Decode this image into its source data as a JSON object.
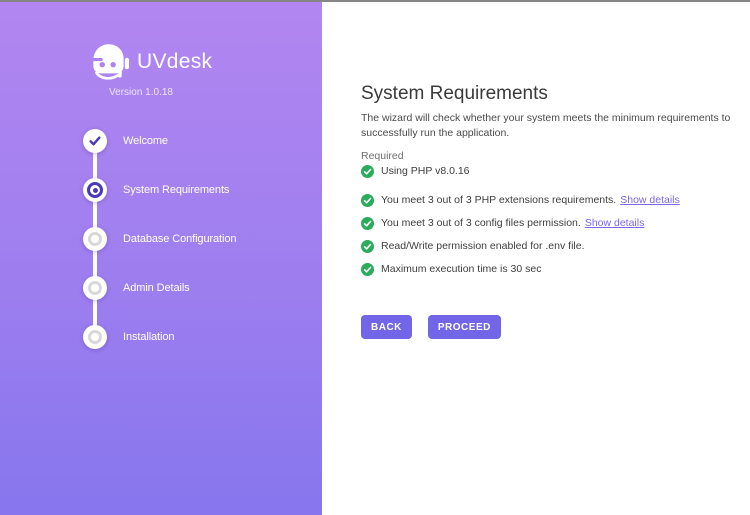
{
  "window": {
    "top_border_color": "#858585"
  },
  "sidebar": {
    "logo": {
      "brand": "UVdesk",
      "version": "Version 1.0.18",
      "icon": "headset-agent-icon"
    },
    "colors": {
      "gradient_top": "#b286f0",
      "gradient_bottom": "#8776ee",
      "accent_indigo": "#4839bb",
      "pending_ring_gray": "#d8d8d8"
    },
    "steps": [
      {
        "label": "Welcome",
        "state": "completed",
        "icon": "check-icon"
      },
      {
        "label": "System Requirements",
        "state": "active",
        "icon": "radio-ring-icon"
      },
      {
        "label": "Database Configuration",
        "state": "pending",
        "icon": "ring-icon"
      },
      {
        "label": "Admin Details",
        "state": "pending",
        "icon": "ring-icon"
      },
      {
        "label": "Installation",
        "state": "pending",
        "icon": "ring-icon"
      }
    ]
  },
  "main": {
    "title": "System Requirements",
    "description": "The wizard will check whether your system meets the minimum requirements to successfully run the application.",
    "section_label": "Required",
    "requirements": [
      {
        "status": "pass",
        "icon": "success-check-icon",
        "text": "Using PHP v8.0.16"
      },
      {
        "status": "pass",
        "icon": "success-check-icon",
        "text": "You meet 3 out of 3 PHP extensions requirements.",
        "link_label": "Show details"
      },
      {
        "status": "pass",
        "icon": "success-check-icon",
        "text": "You meet 3 out of 3 config files permission.",
        "link_label": "Show details"
      },
      {
        "status": "pass",
        "icon": "success-check-icon",
        "text": "Read/Write permission enabled for .env file."
      },
      {
        "status": "pass",
        "icon": "success-check-icon",
        "text": "Maximum execution time is 30 sec"
      }
    ],
    "actions": {
      "back": "BACK",
      "proceed": "PROCEED"
    },
    "colors": {
      "success_green": "#2bab5c",
      "link_purple": "#7d66ea",
      "button_purple": "#7265e8"
    }
  }
}
